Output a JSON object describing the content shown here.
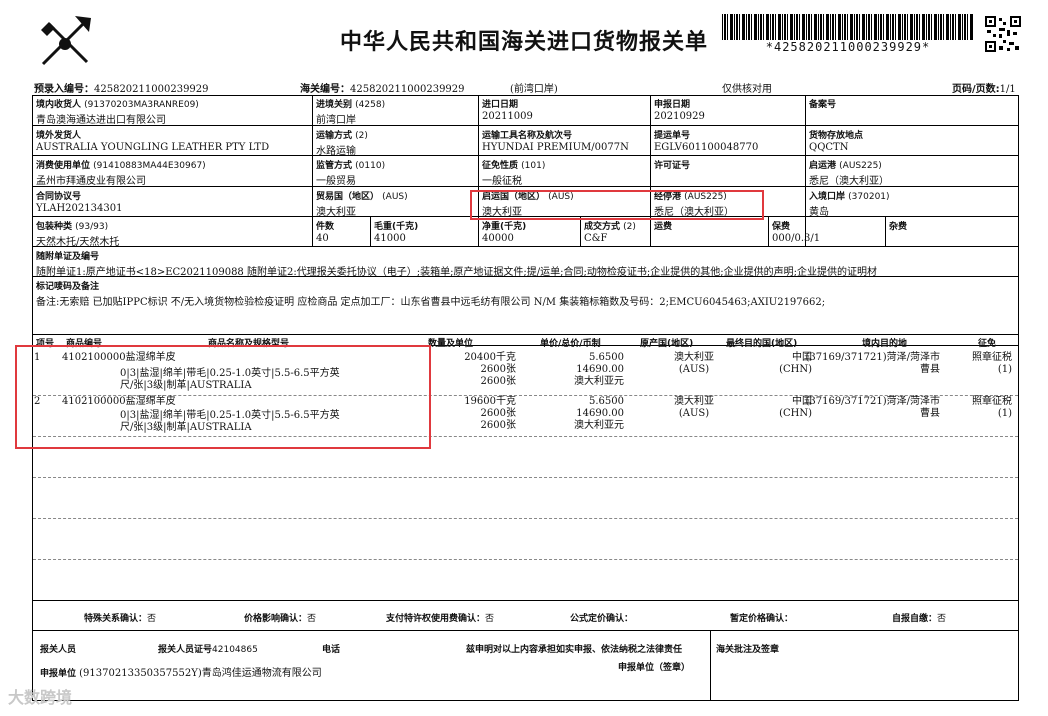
{
  "title": "中华人民共和国海关进口货物报关单",
  "barcode_text": "*425820211000239929*",
  "header": {
    "pre_entry_label": "预录入编号：",
    "pre_entry_no": "425820211000239929",
    "customs_no_label": "海关编号：",
    "customs_no": "425820211000239929",
    "port_note": "(前湾口岸)",
    "verify_note": "仅供核对用",
    "page_label": "页码/页数:",
    "page_value": "1/1"
  },
  "row1": {
    "consignee_label": "境内收货人",
    "consignee_code": "(91370203MA3RANRE09)",
    "consignee": "青岛澳海通达进出口有限公司",
    "entry_customs_label": "进境关别",
    "entry_customs_code": "(4258)",
    "entry_customs": "前湾口岸",
    "import_date_label": "进口日期",
    "import_date": "20211009",
    "declare_date_label": "申报日期",
    "declare_date": "20210929",
    "record_no_label": "备案号",
    "record_no": ""
  },
  "row2": {
    "shipper_label": "境外发货人",
    "shipper": "AUSTRALIA YOUNGLING LEATHER PTY LTD",
    "transport_mode_label": "运输方式",
    "transport_mode_code": "(2)",
    "transport_mode": "水路运输",
    "vessel_label": "运输工具名称及航次号",
    "vessel": "HYUNDAI PREMIUM/0077N",
    "bl_label": "提运单号",
    "bl_no": "EGLV601100048770",
    "storage_label": "货物存放地点",
    "storage": "QQCTN"
  },
  "row3": {
    "user_label": "消费使用单位",
    "user_code": "(91410883MA44E30967)",
    "user": "孟州市拜通皮业有限公司",
    "supervision_label": "监管方式",
    "supervision_code": "(0110)",
    "supervision": "一般贸易",
    "tax_label": "征免性质",
    "tax_code": "(101)",
    "tax": "一般征税",
    "license_label": "许可证号",
    "license": "",
    "dep_port_label": "启运港",
    "dep_port_code": "(AUS225)",
    "dep_port": "悉尼（澳大利亚）"
  },
  "row4": {
    "contract_label": "合同协议号",
    "contract": "YLAH202134301",
    "trade_country_label": "贸易国（地区）",
    "trade_country_code": "(AUS)",
    "trade_country": "澳大利亚",
    "origin_country_label": "启运国（地区）",
    "origin_country_code": "(AUS)",
    "origin_country": "澳大利亚",
    "transit_port_label": "经停港",
    "transit_port_code": "(AUS225)",
    "transit_port": "悉尼（澳大利亚）",
    "entry_port_label": "入境口岸",
    "entry_port_code": "(370201)",
    "entry_port": "黄岛"
  },
  "row5": {
    "package_label": "包装种类",
    "package_code": "(93/93)",
    "package": "天然木托/天然木托",
    "pieces_label": "件数",
    "pieces": "40",
    "gross_label": "毛重(千克)",
    "gross": "41000",
    "net_label": "净重(千克)",
    "net": "40000",
    "deal_label": "成交方式",
    "deal_code": "(2)",
    "deal": "C&F",
    "freight_label": "运费",
    "freight": "",
    "insurance_label": "保费",
    "insurance": "000/0.3/1",
    "misc_label": "杂费",
    "misc": ""
  },
  "docs": {
    "label": "随附单证及编号",
    "text": "随附单证1:原产地证书<18>EC2021109088 随附单证2:代理报关委托协议（电子）;装箱单;原产地证据文件;提/运单;合同;动物检疫证书;企业提供的其他;企业提供的声明;企业提供的证明材"
  },
  "remarks": {
    "label": "标记唛码及备注",
    "text": "备注:无索赔 已加贴IPPC标识 不/无入境货物检验检疫证明 应检商品 定点加工厂：山东省曹县中远毛纺有限公司 N/M  集装箱标箱数及号码：2;EMCU6045463;AXIU2197662;"
  },
  "goods_header": {
    "seq": "项号",
    "code": "商品编号",
    "name": "商品名称及规格型号",
    "qty": "数量及单位",
    "price": "单价/总价/币制",
    "origin": "原产国(地区)",
    "dest": "最终目的国(地区)",
    "domestic": "境内目的地",
    "levy": "征免"
  },
  "goods": [
    {
      "seq": "1",
      "code": "4102100000",
      "name": "盐湿绵羊皮",
      "spec1": "0|3|盐湿|绵羊|带毛|0.25-1.0英寸|5.5-6.5平方英",
      "spec2": "尺/张|3级|制革|AUSTRALIA",
      "qty1": "20400千克",
      "qty2": "2600张",
      "qty3": "2600张",
      "price1": "5.6500",
      "price2": "14690.00",
      "price3": "澳大利亚元",
      "origin": "澳大利亚",
      "origin_code": "(AUS)",
      "dest": "中国",
      "dest_code": "(CHN)",
      "domestic1": "(37169/371721)菏泽/菏泽市",
      "domestic2": "曹县",
      "levy1": "照章征税",
      "levy2": "(1)"
    },
    {
      "seq": "2",
      "code": "4102100000",
      "name": "盐湿绵羊皮",
      "spec1": "0|3|盐湿|绵羊|带毛|0.25-1.0英寸|5.5-6.5平方英",
      "spec2": "尺/张|3级|制革|AUSTRALIA",
      "qty1": "19600千克",
      "qty2": "2600张",
      "qty3": "2600张",
      "price1": "5.6500",
      "price2": "14690.00",
      "price3": "澳大利亚元",
      "origin": "澳大利亚",
      "origin_code": "(AUS)",
      "dest": "中国",
      "dest_code": "(CHN)",
      "domestic1": "(37169/371721)菏泽/菏泽市",
      "domestic2": "曹县",
      "levy1": "照章征税",
      "levy2": "(1)"
    }
  ],
  "confirm": {
    "special_label": "特殊关系确认：",
    "special": "否",
    "price_label": "价格影响确认：",
    "price": "否",
    "royalty_label": "支付特许权使用费确认：",
    "royalty": "否",
    "formula_label": "公式定价确认：",
    "formula": "",
    "provisional_label": "暂定价格确认：",
    "provisional": "",
    "self_label": "自报自缴：",
    "self": "否"
  },
  "footer": {
    "declarer_label": "报关人员",
    "declarer_no_label": "报关人员证号",
    "declarer_no": "42104865",
    "phone_label": "电话",
    "statement": "兹申明对以上内容承担如实申报、依法纳税之法律责任",
    "customs_note_label": "海关批注及签章",
    "unit_label": "申报单位",
    "unit": "(91370213350357552Y)青岛鸿佳运通物流有限公司",
    "unit_sign_label": "申报单位（签章）"
  },
  "watermark": "大数跨境"
}
